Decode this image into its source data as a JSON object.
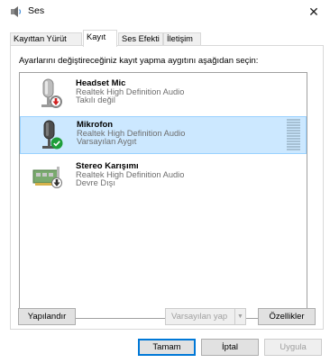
{
  "window": {
    "title": "Ses",
    "close_glyph": "✕"
  },
  "tabs": [
    {
      "label": "Kayıttan Yürüt",
      "active": false
    },
    {
      "label": "Kayıt",
      "active": true
    },
    {
      "label": "Ses Efekti",
      "active": false
    },
    {
      "label": "İletişim",
      "active": false
    }
  ],
  "instruction": "Ayarlarını değiştireceğiniz kayıt yapma aygıtını aşağıdan seçin:",
  "devices": [
    {
      "name": "Headset Mic",
      "driver": "Realtek High Definition Audio",
      "status": "Takılı değil",
      "icon": "microphone-icon",
      "badge": "unplugged-red-arrow-badge",
      "selected": false
    },
    {
      "name": "Mikrofon",
      "driver": "Realtek High Definition Audio",
      "status": "Varsayılan Aygıt",
      "icon": "microphone-icon",
      "badge": "default-green-check-badge",
      "selected": true
    },
    {
      "name": "Stereo Karışımı",
      "driver": "Realtek High Definition Audio",
      "status": "Devre Dışı",
      "icon": "sound-card-icon",
      "badge": "disabled-down-arrow-badge",
      "selected": false
    }
  ],
  "buttons": {
    "configure": "Yapılandır",
    "set_default": "Varsayılan yap",
    "properties": "Özellikler",
    "ok": "Tamam",
    "cancel": "İptal",
    "apply": "Uygula"
  },
  "colors": {
    "selection": "#cce8ff",
    "accent": "#0078d7",
    "green_badge": "#1e9e3a",
    "red_badge": "#d02020"
  }
}
